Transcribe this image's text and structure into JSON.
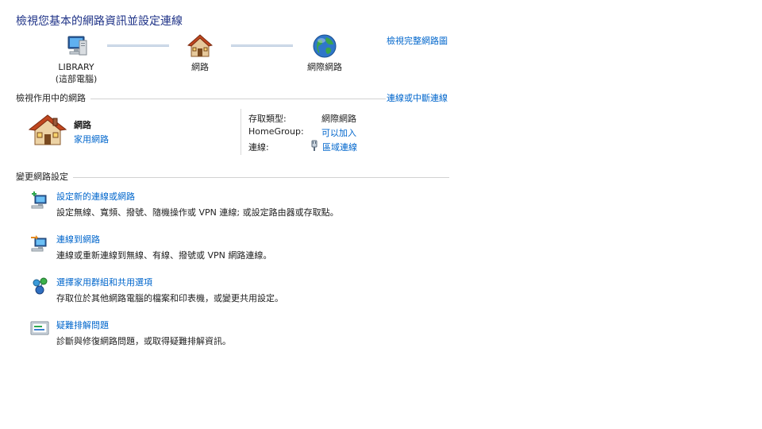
{
  "header": {
    "title": "檢視您基本的網路資訊並設定連線",
    "view_full_map": "檢視完整網路圖"
  },
  "network_map": {
    "computer_name": "LIBRARY",
    "computer_sub": "(這部電腦)",
    "network_label": "網路",
    "internet_label": "網際網路"
  },
  "active_networks": {
    "section_title": "檢視作用中的網路",
    "connect_disconnect": "連線或中斷連線",
    "network_name": "網路",
    "network_type": "家用網路",
    "props": {
      "access_type_label": "存取類型:",
      "access_type_value": "網際網路",
      "homegroup_label": "HomeGroup:",
      "homegroup_value": "可以加入",
      "connections_label": "連線:",
      "connections_value": "區域連線"
    }
  },
  "change_settings": {
    "section_title": "變更網路設定",
    "tasks": [
      {
        "title": "設定新的連線或網路",
        "desc": "設定無線、寬頻、撥號、隨機操作或 VPN 連線; 或設定路由器或存取點。",
        "icon": "new-connection-icon"
      },
      {
        "title": "連線到網路",
        "desc": "連線或重新連線到無線、有線、撥號或 VPN 網路連線。",
        "icon": "connect-network-icon"
      },
      {
        "title": "選擇家用群組和共用選項",
        "desc": "存取位於其他網路電腦的檔案和印表機，或變更共用設定。",
        "icon": "homegroup-icon"
      },
      {
        "title": "疑難排解問題",
        "desc": "診斷與修復網路問題，或取得疑難排解資訊。",
        "icon": "troubleshoot-icon"
      }
    ]
  },
  "colors": {
    "link": "#0066cc",
    "title": "#1e3287"
  }
}
